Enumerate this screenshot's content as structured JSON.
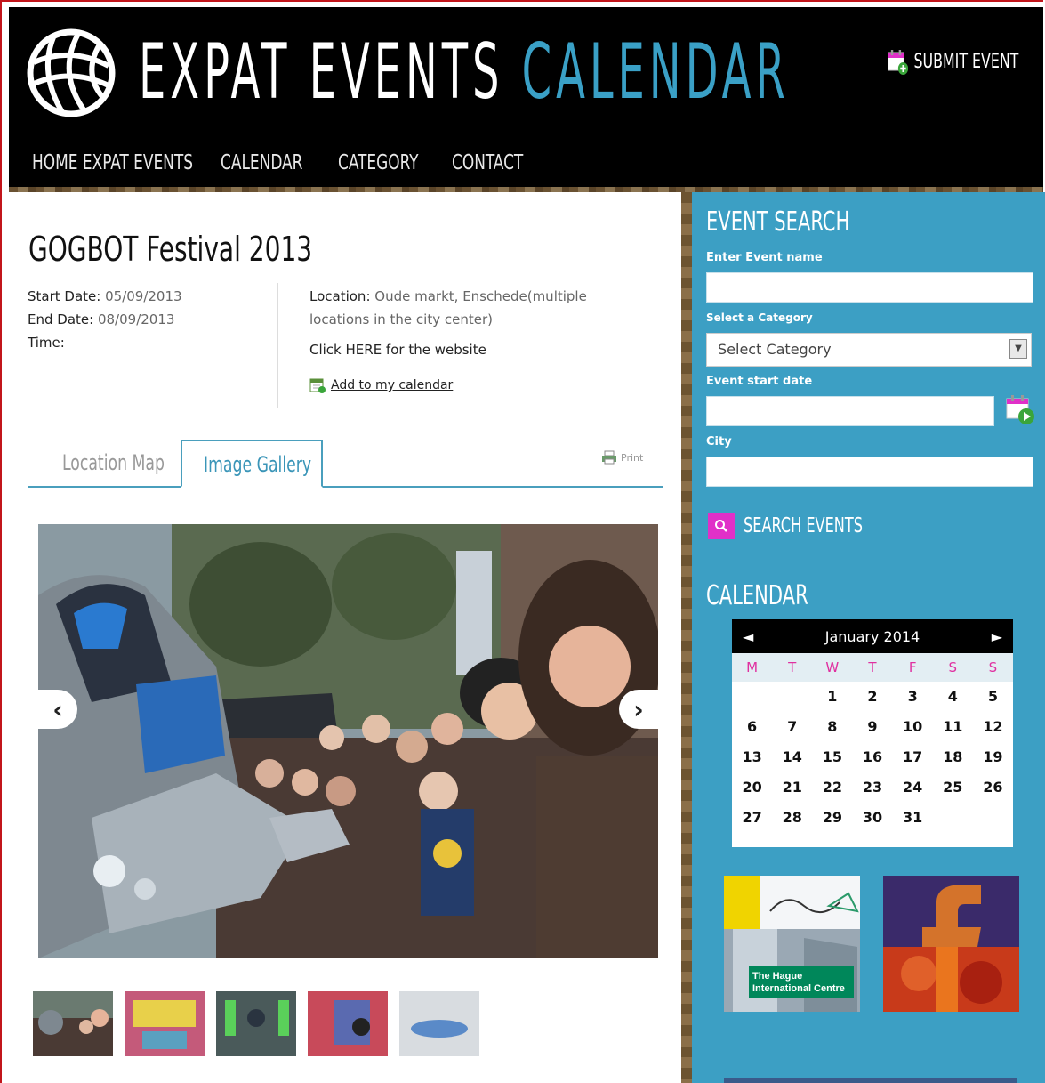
{
  "header": {
    "logo_white": "EXPAT EVENTS",
    "logo_blue": "CALENDAR",
    "submit_label": "SUBMIT EVENT"
  },
  "nav": {
    "items": [
      {
        "label": "HOME EXPAT EVENTS"
      },
      {
        "label": "CALENDAR"
      },
      {
        "label": "CATEGORY"
      },
      {
        "label": "CONTACT"
      }
    ]
  },
  "event": {
    "title": "GOGBOT Festival 2013",
    "start_label": "Start Date:",
    "start_value": "05/09/2013",
    "end_label": "End Date:",
    "end_value": "08/09/2013",
    "time_label": "Time:",
    "location_label": "Location:",
    "location_value": "Oude markt, Enschede(multiple locations in the city center)",
    "website_link": "Click HERE for the website",
    "add_calendar": "Add to my calendar"
  },
  "tabs": {
    "location_map": "Location Map",
    "image_gallery": "Image Gallery",
    "print": "Print"
  },
  "sidebar": {
    "search_heading": "EVENT SEARCH",
    "event_name_label": "Enter Event name",
    "category_label": "Select a Category",
    "category_selected": "Select Category",
    "start_date_label": "Event start date",
    "city_label": "City",
    "search_button": "SEARCH EVENTS",
    "calendar_heading": "CALENDAR",
    "ad1_text1": "The Hague",
    "ad1_text2": "International Centre"
  },
  "calendar": {
    "month": "January 2014",
    "prev": "◄",
    "next": "►",
    "weekdays": [
      "M",
      "T",
      "W",
      "T",
      "F",
      "S",
      "S"
    ],
    "cells": [
      "",
      "",
      "1",
      "2",
      "3",
      "4",
      "5",
      "6",
      "7",
      "8",
      "9",
      "10",
      "11",
      "12",
      "13",
      "14",
      "15",
      "16",
      "17",
      "18",
      "19",
      "20",
      "21",
      "22",
      "23",
      "24",
      "25",
      "26",
      "27",
      "28",
      "29",
      "30",
      "31",
      "",
      ""
    ]
  },
  "colors": {
    "header_bg": "#000000",
    "accent_blue": "#3c9fc4",
    "logo_blue": "#3aa0c6",
    "search_icon_bg": "#e030c8",
    "weekday_color": "#e030a0"
  }
}
